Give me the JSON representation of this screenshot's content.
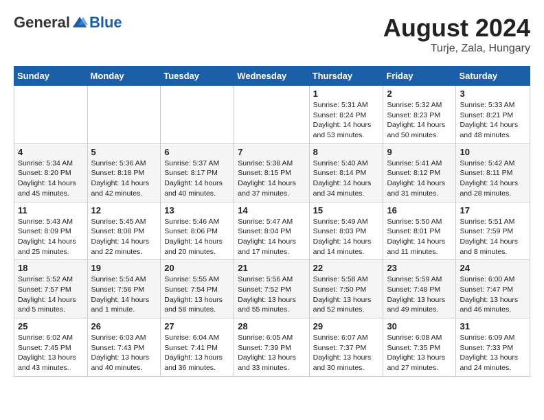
{
  "header": {
    "logo_general": "General",
    "logo_blue": "Blue",
    "month_year": "August 2024",
    "location": "Turje, Zala, Hungary"
  },
  "days_of_week": [
    "Sunday",
    "Monday",
    "Tuesday",
    "Wednesday",
    "Thursday",
    "Friday",
    "Saturday"
  ],
  "weeks": [
    [
      {
        "day": "",
        "content": ""
      },
      {
        "day": "",
        "content": ""
      },
      {
        "day": "",
        "content": ""
      },
      {
        "day": "",
        "content": ""
      },
      {
        "day": "1",
        "content": "Sunrise: 5:31 AM\nSunset: 8:24 PM\nDaylight: 14 hours\nand 53 minutes."
      },
      {
        "day": "2",
        "content": "Sunrise: 5:32 AM\nSunset: 8:23 PM\nDaylight: 14 hours\nand 50 minutes."
      },
      {
        "day": "3",
        "content": "Sunrise: 5:33 AM\nSunset: 8:21 PM\nDaylight: 14 hours\nand 48 minutes."
      }
    ],
    [
      {
        "day": "4",
        "content": "Sunrise: 5:34 AM\nSunset: 8:20 PM\nDaylight: 14 hours\nand 45 minutes."
      },
      {
        "day": "5",
        "content": "Sunrise: 5:36 AM\nSunset: 8:18 PM\nDaylight: 14 hours\nand 42 minutes."
      },
      {
        "day": "6",
        "content": "Sunrise: 5:37 AM\nSunset: 8:17 PM\nDaylight: 14 hours\nand 40 minutes."
      },
      {
        "day": "7",
        "content": "Sunrise: 5:38 AM\nSunset: 8:15 PM\nDaylight: 14 hours\nand 37 minutes."
      },
      {
        "day": "8",
        "content": "Sunrise: 5:40 AM\nSunset: 8:14 PM\nDaylight: 14 hours\nand 34 minutes."
      },
      {
        "day": "9",
        "content": "Sunrise: 5:41 AM\nSunset: 8:12 PM\nDaylight: 14 hours\nand 31 minutes."
      },
      {
        "day": "10",
        "content": "Sunrise: 5:42 AM\nSunset: 8:11 PM\nDaylight: 14 hours\nand 28 minutes."
      }
    ],
    [
      {
        "day": "11",
        "content": "Sunrise: 5:43 AM\nSunset: 8:09 PM\nDaylight: 14 hours\nand 25 minutes."
      },
      {
        "day": "12",
        "content": "Sunrise: 5:45 AM\nSunset: 8:08 PM\nDaylight: 14 hours\nand 22 minutes."
      },
      {
        "day": "13",
        "content": "Sunrise: 5:46 AM\nSunset: 8:06 PM\nDaylight: 14 hours\nand 20 minutes."
      },
      {
        "day": "14",
        "content": "Sunrise: 5:47 AM\nSunset: 8:04 PM\nDaylight: 14 hours\nand 17 minutes."
      },
      {
        "day": "15",
        "content": "Sunrise: 5:49 AM\nSunset: 8:03 PM\nDaylight: 14 hours\nand 14 minutes."
      },
      {
        "day": "16",
        "content": "Sunrise: 5:50 AM\nSunset: 8:01 PM\nDaylight: 14 hours\nand 11 minutes."
      },
      {
        "day": "17",
        "content": "Sunrise: 5:51 AM\nSunset: 7:59 PM\nDaylight: 14 hours\nand 8 minutes."
      }
    ],
    [
      {
        "day": "18",
        "content": "Sunrise: 5:52 AM\nSunset: 7:57 PM\nDaylight: 14 hours\nand 5 minutes."
      },
      {
        "day": "19",
        "content": "Sunrise: 5:54 AM\nSunset: 7:56 PM\nDaylight: 14 hours\nand 1 minute."
      },
      {
        "day": "20",
        "content": "Sunrise: 5:55 AM\nSunset: 7:54 PM\nDaylight: 13 hours\nand 58 minutes."
      },
      {
        "day": "21",
        "content": "Sunrise: 5:56 AM\nSunset: 7:52 PM\nDaylight: 13 hours\nand 55 minutes."
      },
      {
        "day": "22",
        "content": "Sunrise: 5:58 AM\nSunset: 7:50 PM\nDaylight: 13 hours\nand 52 minutes."
      },
      {
        "day": "23",
        "content": "Sunrise: 5:59 AM\nSunset: 7:48 PM\nDaylight: 13 hours\nand 49 minutes."
      },
      {
        "day": "24",
        "content": "Sunrise: 6:00 AM\nSunset: 7:47 PM\nDaylight: 13 hours\nand 46 minutes."
      }
    ],
    [
      {
        "day": "25",
        "content": "Sunrise: 6:02 AM\nSunset: 7:45 PM\nDaylight: 13 hours\nand 43 minutes."
      },
      {
        "day": "26",
        "content": "Sunrise: 6:03 AM\nSunset: 7:43 PM\nDaylight: 13 hours\nand 40 minutes."
      },
      {
        "day": "27",
        "content": "Sunrise: 6:04 AM\nSunset: 7:41 PM\nDaylight: 13 hours\nand 36 minutes."
      },
      {
        "day": "28",
        "content": "Sunrise: 6:05 AM\nSunset: 7:39 PM\nDaylight: 13 hours\nand 33 minutes."
      },
      {
        "day": "29",
        "content": "Sunrise: 6:07 AM\nSunset: 7:37 PM\nDaylight: 13 hours\nand 30 minutes."
      },
      {
        "day": "30",
        "content": "Sunrise: 6:08 AM\nSunset: 7:35 PM\nDaylight: 13 hours\nand 27 minutes."
      },
      {
        "day": "31",
        "content": "Sunrise: 6:09 AM\nSunset: 7:33 PM\nDaylight: 13 hours\nand 24 minutes."
      }
    ]
  ]
}
